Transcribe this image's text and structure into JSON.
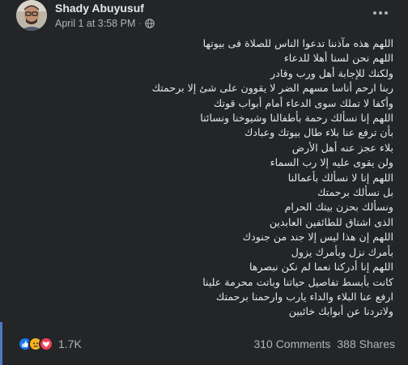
{
  "post": {
    "author": "Shady Abuyusuf",
    "timestamp": "April 1 at 3:58 PM",
    "separator": "·",
    "privacy_icon": "globe-icon",
    "more_icon": "more-options-icon",
    "body_lines": [
      "اللهم هذه مآذننا تدعوا الناس للصلاة فى بيوتها",
      "اللهم نحن لسنا أهلا للدعاء",
      "ولكنك للإجابة أهل ورب وقادر",
      "ربنا ارحم أناسا مسهم الضر لا يقوون على شئ إلا برحمتك",
      "وأكفا لا تملك سوى الدعاء أمام أبواب قوتك",
      "اللهم إنا نسألك رحمة بأطفالنا وشيوخنا ونسائنا",
      "بأن ترفع عنا بلاء طال بيوتك وعبادك",
      "بلاء عجز عنه أهل الأرض",
      "ولن يقوى عليه إلا رب السماء",
      "اللهم إنا لا نسألك بأعمالنا",
      "بل نسألك برحمتك",
      "ونسألك بحزن بيتك الحرام",
      "الذى اشتاق للطائفين  العابدين",
      "اللهم إن هذا ليس إلا جند من جنودك",
      "بأمرك نزل وبأمرك يزول",
      "اللهم إنا أدركنا نعما لم نكن نبصرها",
      "كانت بأبسط تفاصيل حياتنا وباتت محرمة علينا",
      "ارفع عنا البلاء والداء يارب وارحمنا برحمتك",
      "ولاتردنا عن أبوابك خائبين"
    ]
  },
  "footer": {
    "reactions": [
      {
        "name": "like-reaction-icon",
        "color": "#1877f2"
      },
      {
        "name": "sad-reaction-icon",
        "color": "#f7b125"
      },
      {
        "name": "love-reaction-icon",
        "color": "#f33e58"
      }
    ],
    "reaction_count": "1.7K",
    "comments": "310 Comments",
    "shares": "388 Shares"
  }
}
